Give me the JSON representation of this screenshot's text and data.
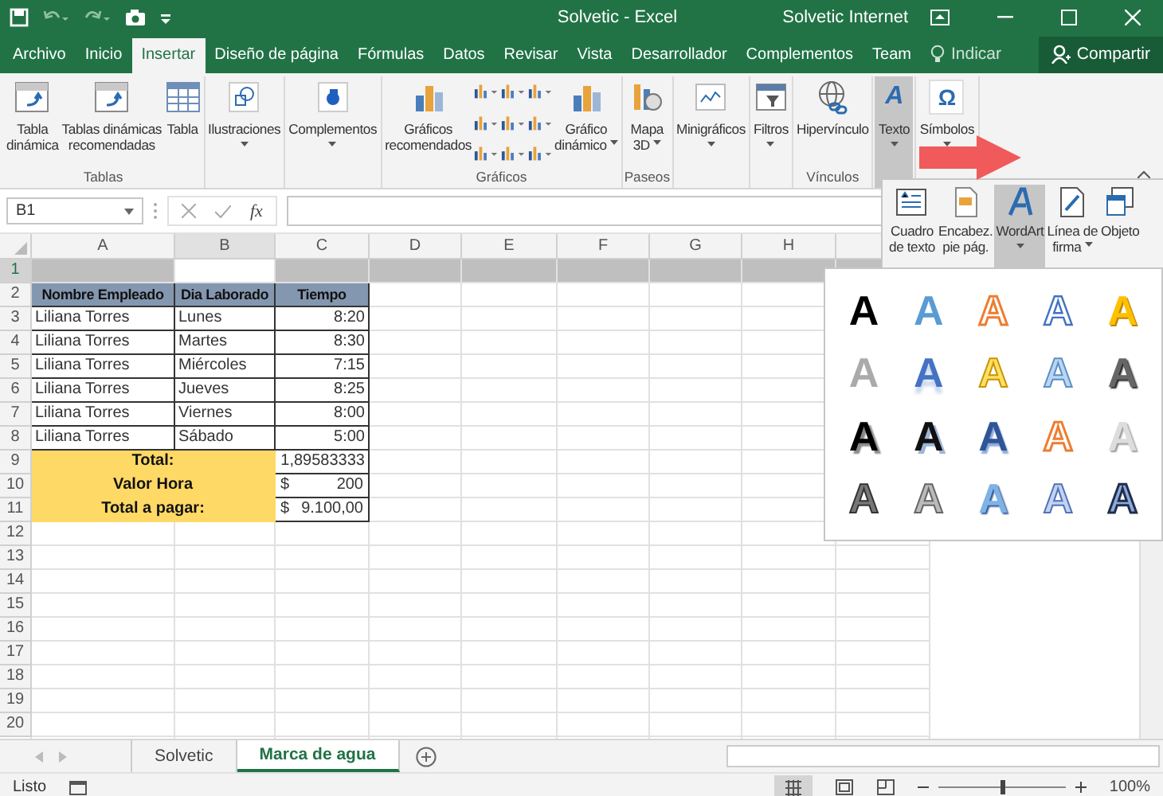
{
  "window": {
    "title": "Solvetic - Excel",
    "user": "Solvetic Internet"
  },
  "ribbon_tabs": [
    {
      "label": "Archivo",
      "selected": false
    },
    {
      "label": "Inicio",
      "selected": false
    },
    {
      "label": "Insertar",
      "selected": true
    },
    {
      "label": "Diseño de página",
      "selected": false
    },
    {
      "label": "Fórmulas",
      "selected": false
    },
    {
      "label": "Datos",
      "selected": false
    },
    {
      "label": "Revisar",
      "selected": false
    },
    {
      "label": "Vista",
      "selected": false
    },
    {
      "label": "Desarrollador",
      "selected": false
    },
    {
      "label": "Complementos",
      "selected": false
    },
    {
      "label": "Team",
      "selected": false
    }
  ],
  "tell_me": "Indicar",
  "share": "Compartir",
  "ribbon_groups": [
    {
      "label": "Tablas",
      "buttons": [
        {
          "kind": "large",
          "lines": [
            "Tabla",
            "dinámica"
          ],
          "dropdown": false,
          "selected": false
        },
        {
          "kind": "large",
          "lines": [
            "Tablas dinámicas",
            "recomendadas"
          ],
          "dropdown": false,
          "selected": false
        },
        {
          "kind": "large",
          "lines": [
            "Tabla"
          ],
          "dropdown": false,
          "selected": false
        }
      ]
    },
    {
      "buttons": [
        {
          "kind": "large",
          "lines": [
            "Ilustraciones"
          ],
          "dropdown": true,
          "selected": false
        }
      ]
    },
    {
      "buttons": [
        {
          "kind": "large",
          "lines": [
            "Complementos"
          ],
          "dropdown": true,
          "selected": false
        }
      ]
    },
    {
      "label": "Gráficos",
      "buttons": [
        {
          "kind": "large",
          "lines": [
            "Gráficos",
            "recomendados"
          ],
          "dropdown": false,
          "selected": false
        },
        {
          "kind": "chart-grid"
        },
        {
          "kind": "large",
          "lines": [
            "Gráfico",
            "dinámico"
          ],
          "dropdown": true,
          "selected": false
        }
      ]
    },
    {
      "label": "Paseos",
      "buttons": [
        {
          "kind": "large",
          "lines": [
            "Mapa",
            "3D"
          ],
          "dropdown": true,
          "selected": false
        }
      ]
    },
    {
      "buttons": [
        {
          "kind": "large",
          "lines": [
            "Minigráficos"
          ],
          "dropdown": true,
          "selected": false
        }
      ]
    },
    {
      "buttons": [
        {
          "kind": "large",
          "lines": [
            "Filtros"
          ],
          "dropdown": true,
          "selected": false
        }
      ]
    },
    {
      "label": "Vínculos",
      "buttons": [
        {
          "kind": "large",
          "lines": [
            "Hipervínculo"
          ],
          "dropdown": false,
          "selected": false
        }
      ]
    },
    {
      "buttons": [
        {
          "kind": "glyph",
          "glyph": "A",
          "lines": [
            "Texto"
          ],
          "dropdown": true,
          "selected": true
        }
      ]
    },
    {
      "buttons": [
        {
          "kind": "glyph",
          "glyph": "Ω",
          "lines": [
            "Símbolos"
          ],
          "dropdown": true,
          "selected": false
        }
      ]
    }
  ],
  "formula_bar": {
    "name_box": "B1",
    "function_label": "fx"
  },
  "sheet": {
    "columns": [
      {
        "label": "A",
        "active": false
      },
      {
        "label": "B",
        "active": true
      },
      {
        "label": "C",
        "active": false
      },
      {
        "label": "D",
        "active": false
      },
      {
        "label": "E",
        "active": false
      },
      {
        "label": "F",
        "active": false
      },
      {
        "label": "G",
        "active": false
      },
      {
        "label": "H",
        "active": false
      }
    ],
    "rows": [
      {
        "label": "1",
        "selected": true
      },
      {
        "label": "2",
        "selected": false
      },
      {
        "label": "3",
        "selected": false
      },
      {
        "label": "4",
        "selected": false
      },
      {
        "label": "5",
        "selected": false
      },
      {
        "label": "6",
        "selected": false
      },
      {
        "label": "7",
        "selected": false
      },
      {
        "label": "8",
        "selected": false
      },
      {
        "label": "9",
        "selected": false
      },
      {
        "label": "10",
        "selected": false
      },
      {
        "label": "11",
        "selected": false
      },
      {
        "label": "12",
        "selected": false
      },
      {
        "label": "13",
        "selected": false
      },
      {
        "label": "14",
        "selected": false
      },
      {
        "label": "15",
        "selected": false
      },
      {
        "label": "16",
        "selected": false
      },
      {
        "label": "17",
        "selected": false
      },
      {
        "label": "18",
        "selected": false
      },
      {
        "label": "19",
        "selected": false
      },
      {
        "label": "20",
        "selected": false
      }
    ]
  },
  "table": {
    "columns": [
      "Nombre Empleado",
      "Dia Laborado",
      "Tiempo"
    ],
    "rows": [
      [
        "Liliana Torres",
        "Lunes",
        "8:20"
      ],
      [
        "Liliana Torres",
        "Martes",
        "8:30"
      ],
      [
        "Liliana Torres",
        "Miércoles",
        "7:15"
      ],
      [
        "Liliana Torres",
        "Jueves",
        "8:25"
      ],
      [
        "Liliana Torres",
        "Viernes",
        "8:00"
      ],
      [
        "Liliana Torres",
        "Sábado",
        "5:00"
      ]
    ],
    "summary": [
      {
        "kind": "number",
        "label": "Total:",
        "value": "1,89583333"
      },
      {
        "kind": "currency",
        "label": "Valor Hora",
        "currency": "$",
        "value": "200"
      },
      {
        "kind": "currency",
        "label": "Total a pagar:",
        "currency": "$",
        "value": "9.100,00"
      }
    ]
  },
  "text_menu": {
    "items": [
      {
        "lines": [
          "Cuadro",
          "de texto"
        ],
        "dropdown": false,
        "selected": false
      },
      {
        "lines": [
          "Encabez.",
          "pie pág."
        ],
        "dropdown": false,
        "selected": false
      },
      {
        "lines": [
          "WordArt"
        ],
        "dropdown": true,
        "selected": true
      },
      {
        "lines": [
          "Línea de",
          "firma"
        ],
        "dropdown": true,
        "selected": false
      },
      {
        "lines": [
          "Objeto"
        ],
        "dropdown": false,
        "selected": false
      }
    ]
  },
  "wordart_gallery": [
    {
      "text": "A",
      "kind": "black"
    },
    {
      "text": "A",
      "kind": "blue"
    },
    {
      "text": "A",
      "kind": "orange-outline"
    },
    {
      "text": "A",
      "kind": "blue-outline"
    },
    {
      "text": "A",
      "kind": "gold"
    },
    {
      "text": "A",
      "kind": "gray"
    },
    {
      "text": "A",
      "kind": "blue-reflect"
    },
    {
      "text": "A",
      "kind": "yellow-outline"
    },
    {
      "text": "A",
      "kind": "light-blue-outline"
    },
    {
      "text": "A",
      "kind": "dark-gradient"
    },
    {
      "text": "A",
      "kind": "black-shadow"
    },
    {
      "text": "A",
      "kind": "black-blue-shadow"
    },
    {
      "text": "A",
      "kind": "blue-bevel"
    },
    {
      "text": "A",
      "kind": "orange-outline"
    },
    {
      "text": "A",
      "kind": "light-gray"
    },
    {
      "text": "A",
      "kind": "hatch-gray"
    },
    {
      "text": "A",
      "kind": "gray-outline"
    },
    {
      "text": "A",
      "kind": "blue-gradient"
    },
    {
      "text": "A",
      "kind": "pale-blue-outline"
    },
    {
      "text": "A",
      "kind": "hatch-dark"
    }
  ],
  "sheet_tabs": [
    {
      "label": "Solvetic",
      "selected": false
    },
    {
      "label": "Marca de agua",
      "selected": true
    }
  ],
  "status_bar": {
    "text": "Listo",
    "zoom": {
      "level": 0.5,
      "label": "100%"
    }
  }
}
